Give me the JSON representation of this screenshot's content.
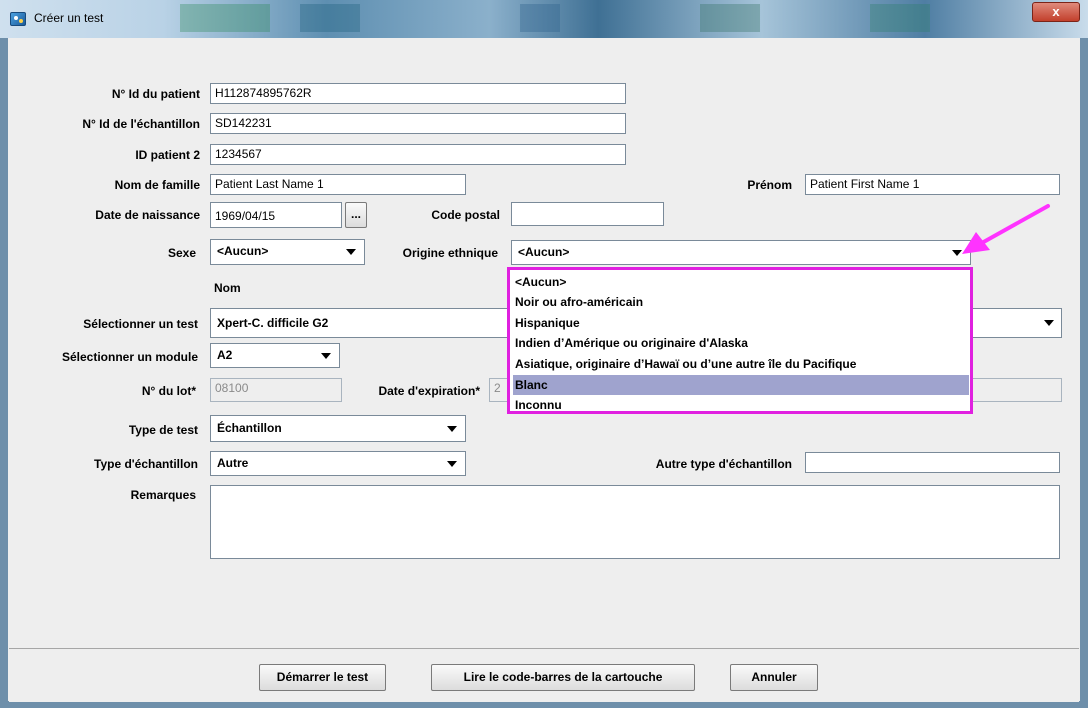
{
  "window": {
    "title": "Créer un test",
    "close_label": "x"
  },
  "form": {
    "patient_id": {
      "label": "N° Id du patient",
      "value": "H112874895762R"
    },
    "sample_id": {
      "label": "N° Id de l'échantillon",
      "value": "SD142231"
    },
    "patient_id2": {
      "label": "ID patient 2",
      "value": "1234567"
    },
    "last_name": {
      "label": "Nom de famille",
      "value": "Patient Last Name 1"
    },
    "first_name": {
      "label": "Prénom",
      "value": "Patient First Name 1"
    },
    "birth_date": {
      "label": "Date de naissance",
      "value": "1969/04/15",
      "picker_label": "..."
    },
    "postal_code": {
      "label": "Code postal",
      "value": ""
    },
    "sex": {
      "label": "Sexe",
      "value": "<Aucun>"
    },
    "ethnic_origin": {
      "label": "Origine ethnique",
      "value": "<Aucun>",
      "options": [
        "<Aucun>",
        "Noir ou afro-américain",
        "Hispanique",
        "Indien d’Amérique ou originaire d'Alaska",
        "Asiatique, originaire d’Hawaï ou d’une autre île du Pacifique",
        "Blanc",
        "Inconnu"
      ],
      "highlighted_option": "Blanc"
    },
    "name_column_header": "Nom",
    "test_select": {
      "label": "Sélectionner un test",
      "value": "Xpert-C. difficile G2"
    },
    "module_select": {
      "label": "Sélectionner un module",
      "value": "A2"
    },
    "lot_number": {
      "label": "N° du lot*",
      "value": "08100"
    },
    "expiration_date": {
      "label": "Date d'expiration*",
      "value": "2"
    },
    "test_type": {
      "label": "Type de test",
      "value": "Échantillon"
    },
    "sample_type": {
      "label": "Type d'échantillon",
      "value": "Autre"
    },
    "other_sample_type": {
      "label": "Autre type d'échantillon",
      "value": ""
    },
    "remarks": {
      "label": "Remarques",
      "value": ""
    }
  },
  "buttons": {
    "start": "Démarrer le test",
    "scan_barcode": "Lire le code-barres de la cartouche",
    "cancel": "Annuler"
  },
  "colors": {
    "highlight_border": "#e020e0",
    "selected_option": "#9fa3ce",
    "annotation_arrow": "#ff33ff"
  }
}
